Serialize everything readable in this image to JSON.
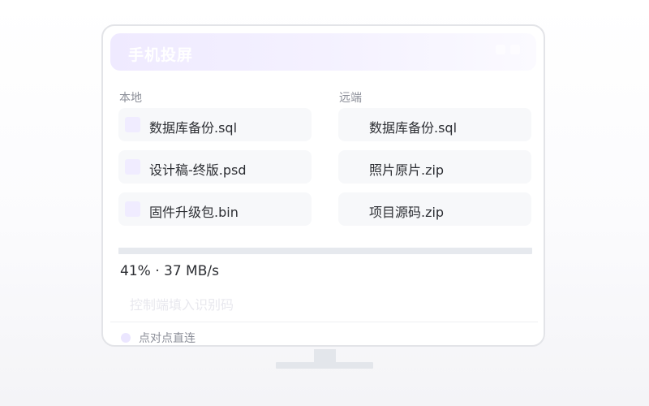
{
  "app": {
    "title": "手机投屏"
  },
  "local": {
    "label": "本地",
    "files": [
      {
        "name": "数据库备份.sql"
      },
      {
        "name": "设计稿-终版.psd"
      },
      {
        "name": "固件升级包.bin"
      }
    ]
  },
  "remote": {
    "label": "远端",
    "files": [
      {
        "name": "数据库备份.sql"
      },
      {
        "name": "照片原片.zip"
      },
      {
        "name": "项目源码.zip"
      }
    ]
  },
  "transfer": {
    "progress_percent": 41,
    "status_text": "41% · 37 MB/s"
  },
  "code_input": {
    "placeholder": "控制端填入识别码",
    "value": ""
  },
  "mode": {
    "label": "点对点直连"
  },
  "colors": {
    "accent_tint": "#efeaff",
    "track": "#e6e9ee",
    "text": "#2c2e33",
    "muted_text": "#8c8f99"
  },
  "icons": {
    "file": "file-icon",
    "status_dot": "dot-icon"
  }
}
